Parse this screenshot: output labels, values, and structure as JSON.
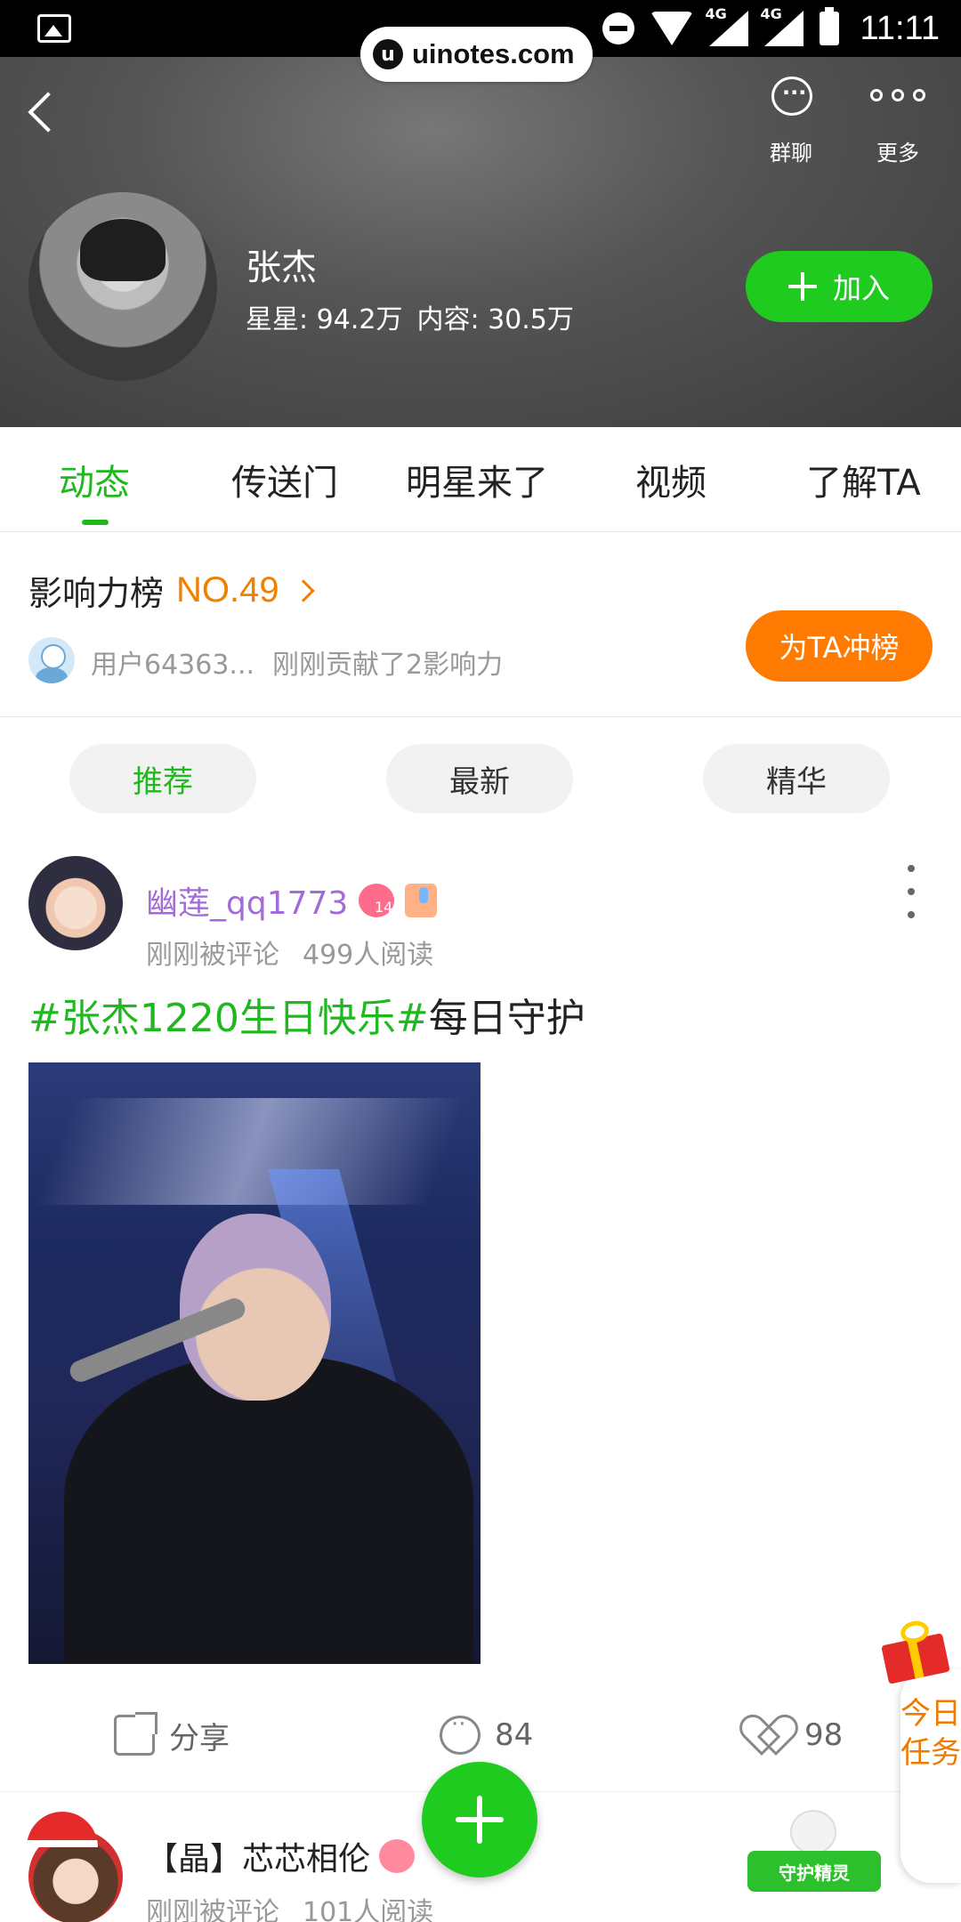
{
  "status_bar": {
    "time": "11:11",
    "network1": "4G",
    "network2": "4G"
  },
  "watermark": {
    "logo": "u",
    "text": "uinotes.com"
  },
  "header": {
    "actions": [
      {
        "label": "群聊",
        "icon": "chat-bubble-icon"
      },
      {
        "label": "更多",
        "icon": "more-dots-icon"
      }
    ],
    "star_name": "张杰",
    "stats": {
      "stars": "星星: 94.2万",
      "content": "内容: 30.5万"
    },
    "join_label": "加入"
  },
  "tabs": [
    "动态",
    "传送门",
    "明星来了",
    "视频",
    "了解TA"
  ],
  "active_tab": "动态",
  "influence": {
    "title": "影响力榜",
    "rank": "NO.49",
    "log_user": "用户64363...",
    "log_text": "刚刚贡献了2影响力",
    "button_label": "为TA冲榜"
  },
  "filters": [
    "推荐",
    "最新",
    "精华"
  ],
  "active_filter": "推荐",
  "post": {
    "username": "幽莲_qq1773",
    "level": "14",
    "time": "刚刚被评论",
    "reads": "499人阅读",
    "tag_text": "#张杰1220生日快乐#",
    "body_text": "每日守护",
    "actions": {
      "share": "分享",
      "comments": "84",
      "likes": "98"
    }
  },
  "post2": {
    "username": "【晶】芯芯相伦",
    "time": "刚刚被评论",
    "reads": "101人阅读",
    "guardian_label": "守护精灵"
  },
  "task": {
    "label": "今日任务"
  },
  "colors": {
    "accent_green": "#1fb81f",
    "accent_orange": "#ff7a00",
    "username_purple": "#a36bd8"
  }
}
